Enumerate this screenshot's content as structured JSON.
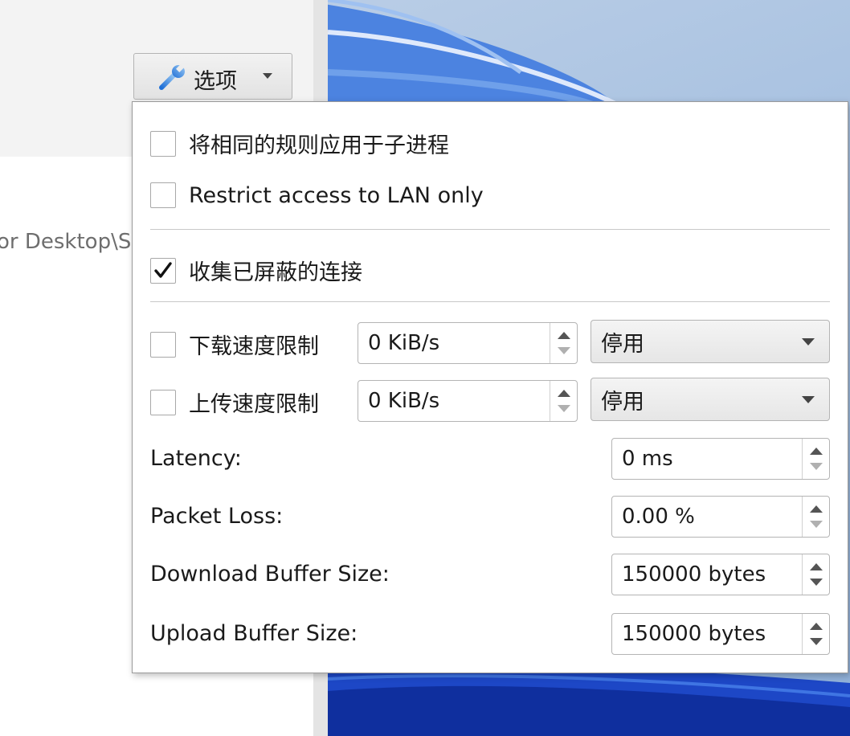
{
  "background": {
    "path_text": "or Desktop\\S"
  },
  "options_button": {
    "label": "选项",
    "icon": "wrench-icon"
  },
  "options_menu": {
    "checkboxes": [
      {
        "label": "将相同的规则应用于子进程",
        "checked": false
      },
      {
        "label": "Restrict access to LAN only",
        "checked": false
      },
      {
        "label": "收集已屏蔽的连接",
        "checked": true
      }
    ],
    "download_limit": {
      "label": "下载速度限制",
      "checked": false,
      "value": "0 KiB/s",
      "mode": "停用"
    },
    "upload_limit": {
      "label": "上传速度限制",
      "checked": false,
      "value": "0 KiB/s",
      "mode": "停用"
    },
    "latency": {
      "label": "Latency:",
      "value": "0 ms"
    },
    "packet_loss": {
      "label": "Packet Loss:",
      "value": "0.00 %"
    },
    "download_buffer": {
      "label": "Download Buffer Size:",
      "value": "150000 bytes"
    },
    "upload_buffer": {
      "label": "Upload Buffer Size:",
      "value": "150000 bytes"
    }
  },
  "colors": {
    "wallpaper_blue": "#1a4fd0",
    "panel_bg": "#ffffff",
    "border": "#b4b4b4"
  }
}
